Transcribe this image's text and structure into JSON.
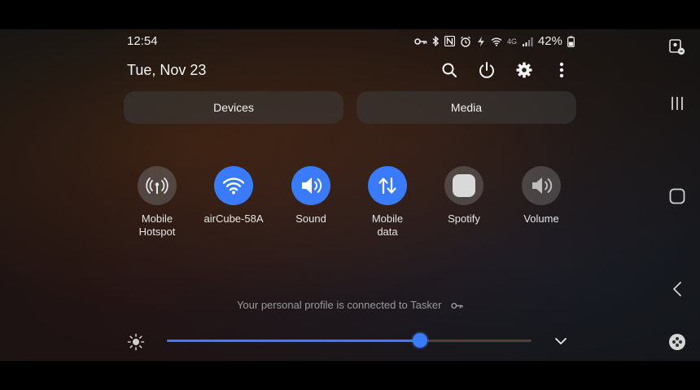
{
  "status_bar": {
    "time": "12:54",
    "battery_percent": "42%",
    "network_type": "4G",
    "icons": [
      "vpn-key-icon",
      "bluetooth-icon",
      "nfc-icon",
      "alarm-icon",
      "data-saver-icon",
      "wifi-icon",
      "signal-icon",
      "battery-icon"
    ]
  },
  "header": {
    "date": "Tue, Nov 23",
    "actions": [
      "search-icon",
      "power-icon",
      "settings-icon",
      "more-options-icon"
    ]
  },
  "buttons": {
    "devices": "Devices",
    "media": "Media"
  },
  "tiles": [
    {
      "label": "Mobile\nHotspot",
      "icon": "hotspot-icon",
      "active": false
    },
    {
      "label": "airCube-58A",
      "icon": "wifi-icon",
      "active": true
    },
    {
      "label": "Sound",
      "icon": "volume-icon",
      "active": true
    },
    {
      "label": "Mobile\ndata",
      "icon": "mobile-data-icon",
      "active": true
    },
    {
      "label": "Spotify",
      "icon": "spotify-icon",
      "active": false
    },
    {
      "label": "Volume",
      "icon": "volume-icon",
      "active": false
    }
  ],
  "profile_note": "Your personal profile is connected to Tasker",
  "brightness": {
    "level": 0.694
  },
  "colors": {
    "accent": "#3a7bfd",
    "tile_off": "#6b6b6b",
    "track_rest": "#5a3a33"
  },
  "nav": [
    "screenshot-assistant-icon",
    "recents-icon",
    "home-icon",
    "back-icon",
    "game-launcher-icon"
  ]
}
